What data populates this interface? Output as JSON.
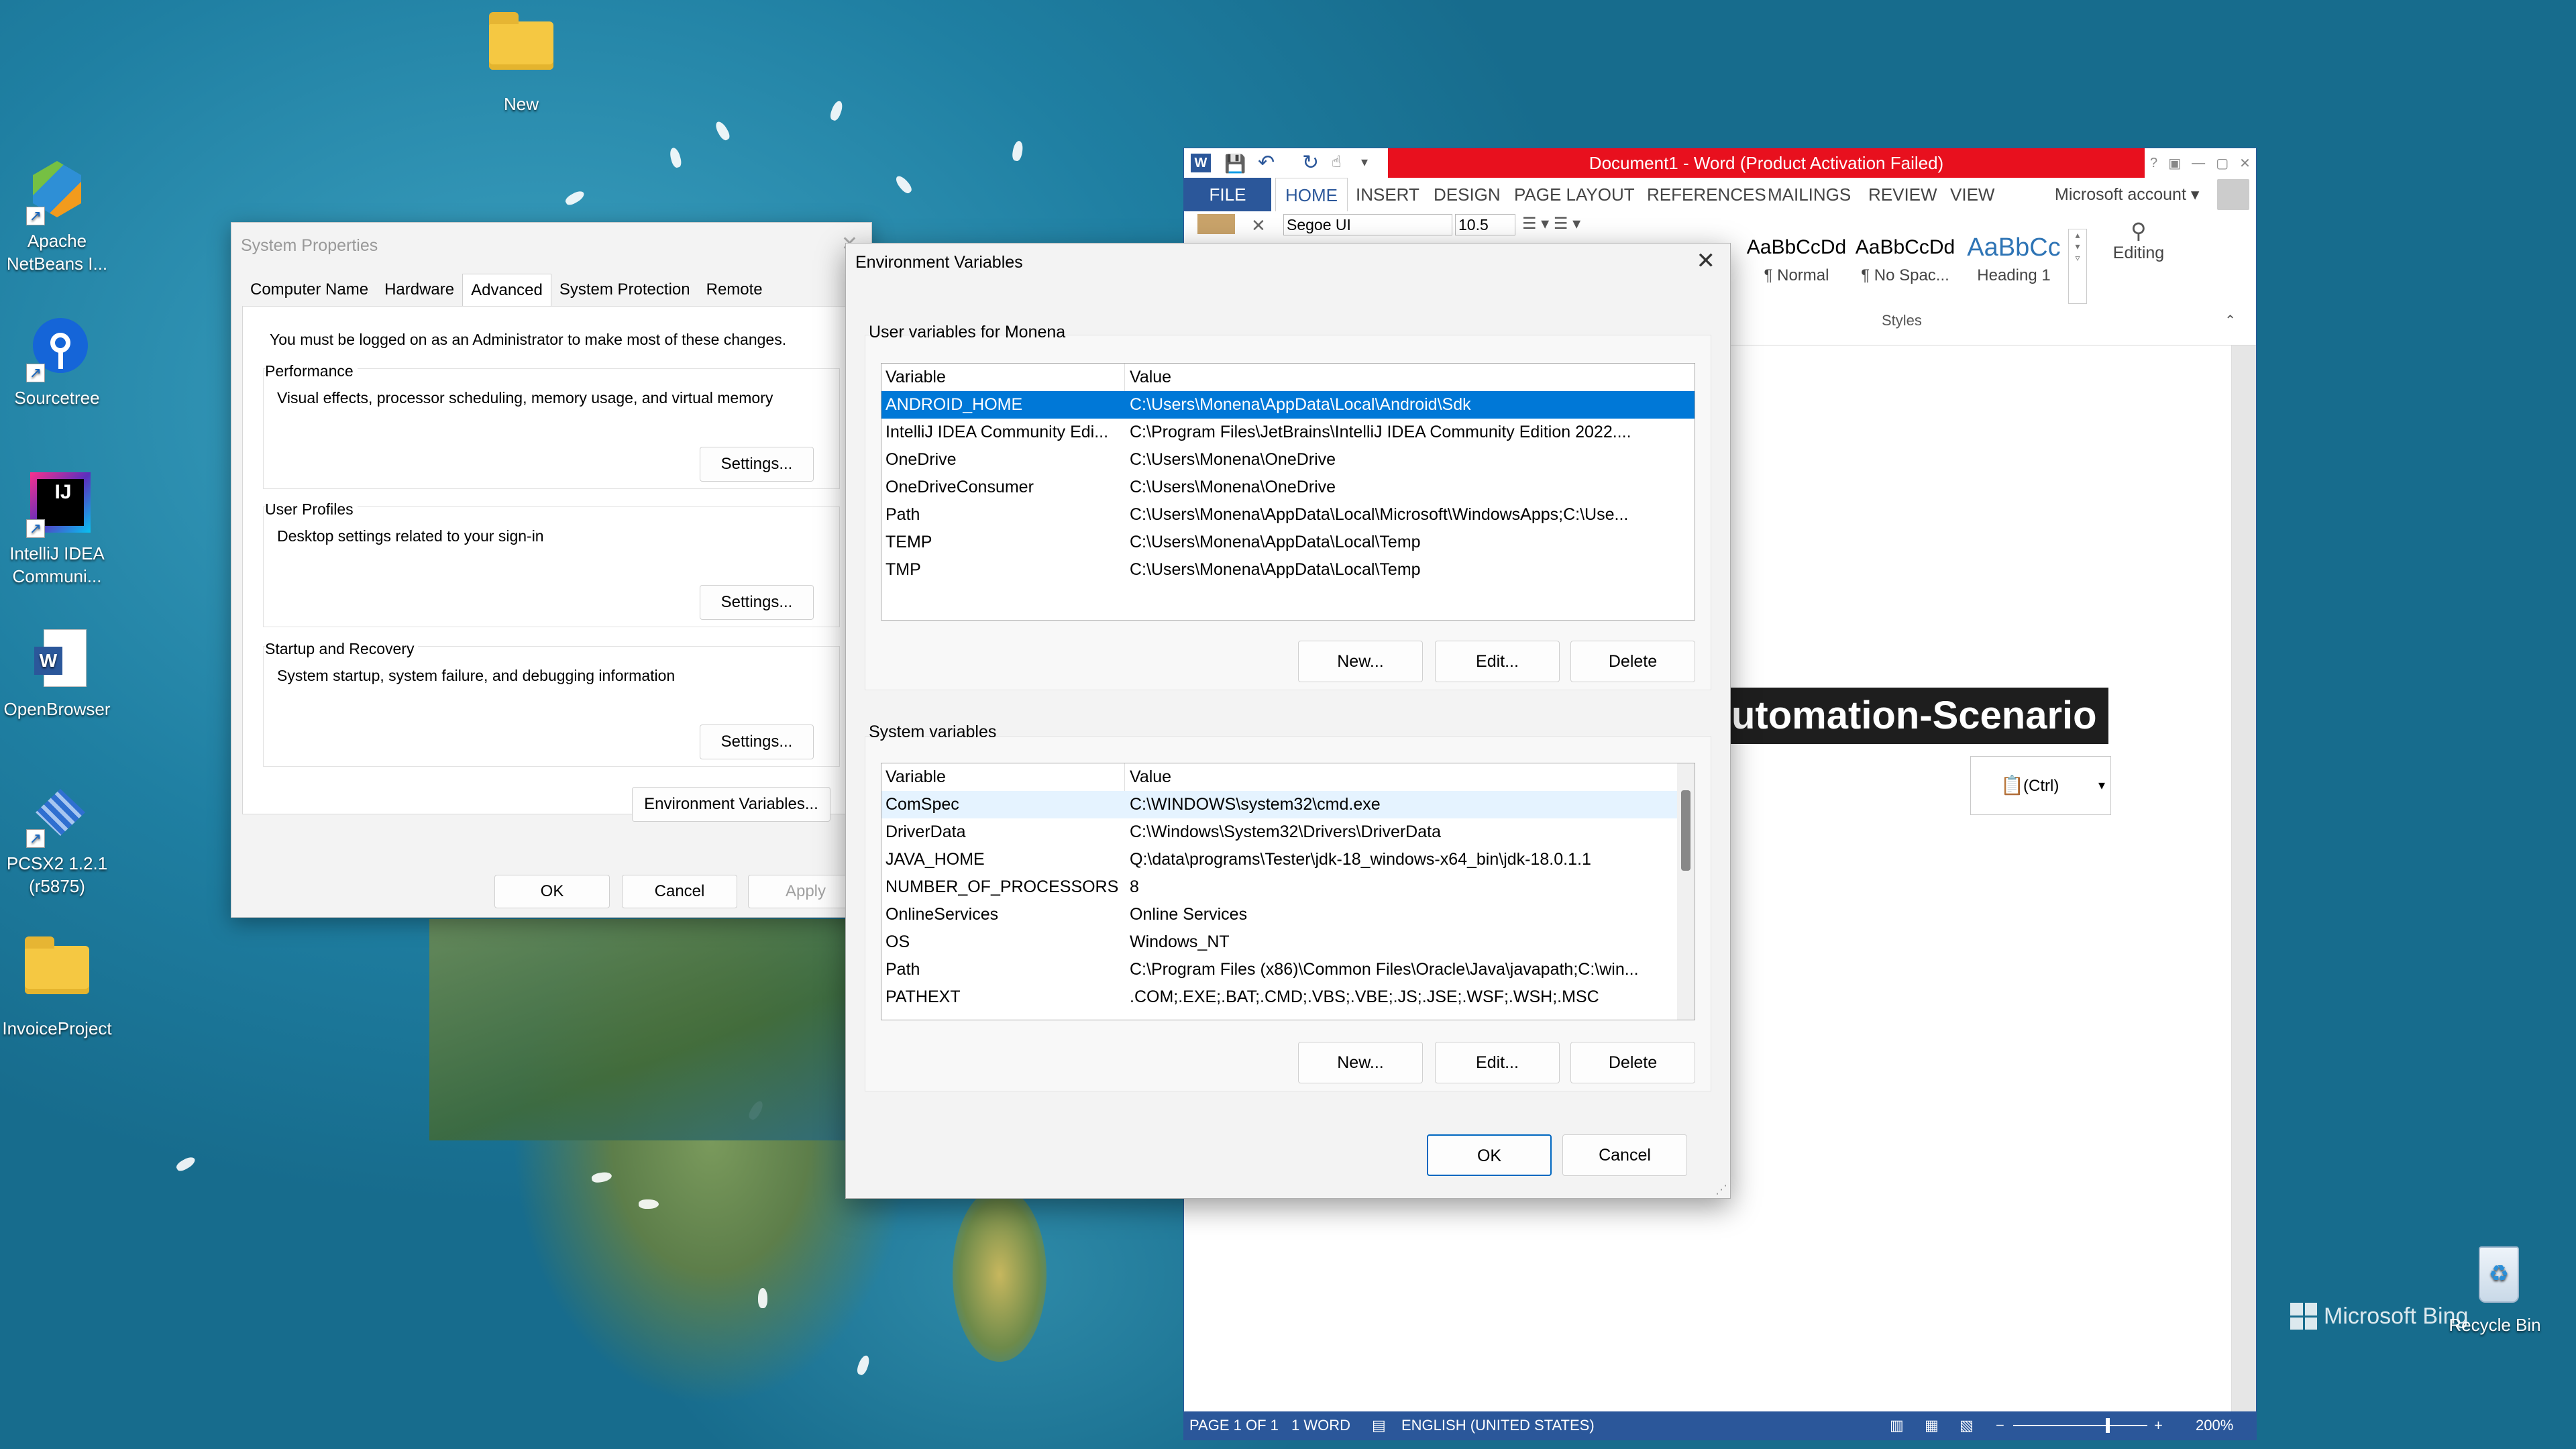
{
  "desktop": {
    "icons": [
      {
        "label": "New"
      },
      {
        "label": "Apache NetBeans I..."
      },
      {
        "label": "Sourcetree"
      },
      {
        "label": "IntelliJ IDEA Communi..."
      },
      {
        "label": "OpenBrowser"
      },
      {
        "label": "PCSX2 1.2.1 (r5875)"
      },
      {
        "label": "InvoiceProject"
      },
      {
        "label": "Recycle Bin"
      }
    ],
    "watermark": "Microsoft Bing"
  },
  "sysprops": {
    "title": "System Properties",
    "tabs": [
      "Computer Name",
      "Hardware",
      "Advanced",
      "System Protection",
      "Remote"
    ],
    "note": "You must be logged on as an Administrator to make most of these changes.",
    "groups": [
      {
        "label": "Performance",
        "desc": "Visual effects, processor scheduling, memory usage, and virtual memory",
        "button": "Settings..."
      },
      {
        "label": "User Profiles",
        "desc": "Desktop settings related to your sign-in",
        "button": "Settings..."
      },
      {
        "label": "Startup and Recovery",
        "desc": "System startup, system failure, and debugging information",
        "button": "Settings..."
      }
    ],
    "env_button": "Environment Variables...",
    "ok": "OK",
    "cancel": "Cancel",
    "apply": "Apply"
  },
  "word": {
    "title": "Document1 -  Word (Product Activation Failed)",
    "menu": [
      "FILE",
      "HOME",
      "INSERT",
      "DESIGN",
      "PAGE LAYOUT",
      "REFERENCES",
      "MAILINGS",
      "REVIEW",
      "VIEW"
    ],
    "account": "Microsoft account",
    "font": "Segoe UI",
    "font_size": "10.5",
    "styles": [
      {
        "sample": "AaBbCcDd",
        "name": "¶ Normal"
      },
      {
        "sample": "AaBbCcDd",
        "name": "¶ No Spac..."
      },
      {
        "sample": "AaBbCc",
        "name": "Heading 1"
      }
    ],
    "styles_group": "Styles",
    "editing": "Editing",
    "doc_text": "utomation-Scenario",
    "paste_options": "(Ctrl)",
    "status": {
      "page": "PAGE 1 OF 1",
      "words": "1 WORD",
      "language": "ENGLISH (UNITED STATES)",
      "zoom": "200%"
    }
  },
  "envvars": {
    "title": "Environment Variables",
    "user_label": "User variables for Monena",
    "system_label": "System variables",
    "col_variable": "Variable",
    "col_value": "Value",
    "user_vars": [
      {
        "name": "ANDROID_HOME",
        "value": "C:\\Users\\Monena\\AppData\\Local\\Android\\Sdk"
      },
      {
        "name": "IntelliJ IDEA Community Edi...",
        "value": "C:\\Program Files\\JetBrains\\IntelliJ IDEA Community Edition 2022...."
      },
      {
        "name": "OneDrive",
        "value": "C:\\Users\\Monena\\OneDrive"
      },
      {
        "name": "OneDriveConsumer",
        "value": "C:\\Users\\Monena\\OneDrive"
      },
      {
        "name": "Path",
        "value": "C:\\Users\\Monena\\AppData\\Local\\Microsoft\\WindowsApps;C:\\Use..."
      },
      {
        "name": "TEMP",
        "value": "C:\\Users\\Monena\\AppData\\Local\\Temp"
      },
      {
        "name": "TMP",
        "value": "C:\\Users\\Monena\\AppData\\Local\\Temp"
      }
    ],
    "system_vars": [
      {
        "name": "ComSpec",
        "value": "C:\\WINDOWS\\system32\\cmd.exe"
      },
      {
        "name": "DriverData",
        "value": "C:\\Windows\\System32\\Drivers\\DriverData"
      },
      {
        "name": "JAVA_HOME",
        "value": "Q:\\data\\programs\\Tester\\jdk-18_windows-x64_bin\\jdk-18.0.1.1"
      },
      {
        "name": "NUMBER_OF_PROCESSORS",
        "value": "8"
      },
      {
        "name": "OnlineServices",
        "value": "Online Services"
      },
      {
        "name": "OS",
        "value": "Windows_NT"
      },
      {
        "name": "Path",
        "value": "C:\\Program Files (x86)\\Common Files\\Oracle\\Java\\javapath;C:\\win..."
      },
      {
        "name": "PATHEXT",
        "value": ".COM;.EXE;.BAT;.CMD;.VBS;.VBE;.JS;.JSE;.WSF;.WSH;.MSC"
      }
    ],
    "btn_new": "New...",
    "btn_edit": "Edit...",
    "btn_delete": "Delete",
    "ok": "OK",
    "cancel": "Cancel"
  }
}
